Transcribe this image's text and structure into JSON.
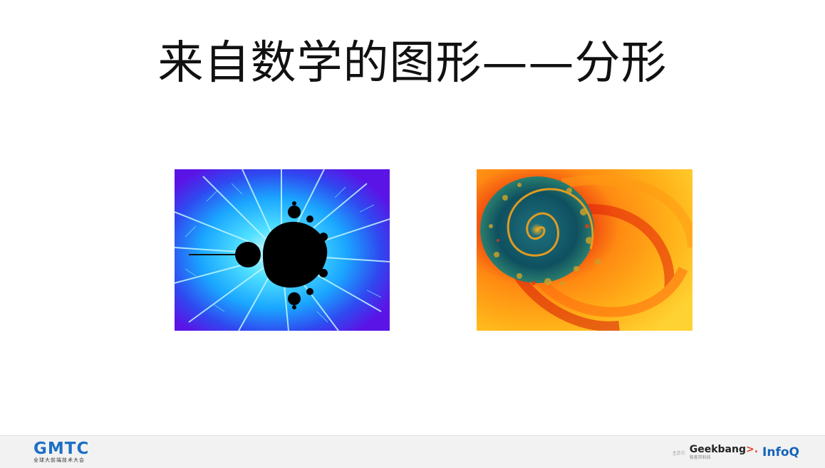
{
  "slide": {
    "title": "来自数学的图形——分形"
  },
  "images": {
    "left_icon": "mandelbrot-fractal",
    "right_icon": "spiral-fractal"
  },
  "footer": {
    "logo_text": "GMTC",
    "logo_subtitle": "全球大前端技术大会",
    "sponsor_label": "主办方",
    "geekbang_text": "Geekbang",
    "geekbang_arrow": ">.",
    "geekbang_subtitle": "极客邦科技",
    "infoq_text": "InfoQ"
  },
  "colors": {
    "brand_blue": "#1f6fc5",
    "infoq_blue": "#1565b8",
    "geekbang_red": "#e2462a",
    "footer_bg": "#f2f2f2"
  }
}
